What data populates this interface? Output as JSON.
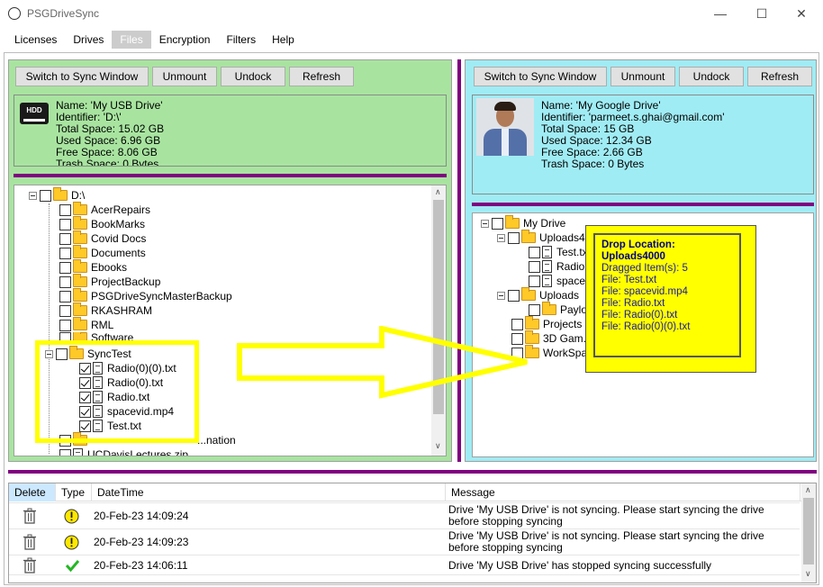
{
  "window": {
    "title": "PSGDriveSync",
    "minimize": "—",
    "maximize": "☐",
    "close": "✕"
  },
  "menu": [
    "Licenses",
    "Drives",
    "Files",
    "Encryption",
    "Filters",
    "Help"
  ],
  "menu_active": "Files",
  "left": {
    "buttons": [
      "Switch to Sync Window",
      "Unmount",
      "Undock",
      "Refresh"
    ],
    "info": {
      "icon_label": "HDD",
      "lines": [
        "Name: 'My USB Drive'",
        "Identifier: 'D:\\'",
        "Total Space: 15.02 GB",
        "Used Space: 6.96 GB",
        "Free Space: 8.06 GB",
        "Trash Space: 0 Bytes"
      ]
    },
    "tree": {
      "root": "D:\\",
      "folders": [
        "AcerRepairs",
        "BookMarks",
        "Covid Docs",
        "Documents",
        "Ebooks",
        "ProjectBackup",
        "PSGDriveSyncMasterBackup",
        "RKASHRAM",
        "RML",
        "Software",
        "SyncTest"
      ],
      "sync_files": [
        "Radio(0)(0).txt",
        "Radio(0).txt",
        "Radio.txt",
        "spacevid.mp4",
        "Test.txt"
      ],
      "partial_item": "...nation",
      "last_file": "UCDavisLectures.zip"
    }
  },
  "right": {
    "buttons": [
      "Switch to Sync Window",
      "Unmount",
      "Undock",
      "Refresh"
    ],
    "info": {
      "lines": [
        "Name: 'My Google Drive'",
        "Identifier: 'parmeet.s.ghai@gmail.com'",
        "Total Space: 15 GB",
        "Used Space: 12.34 GB",
        "Free Space: 2.66 GB",
        "Trash Space: 0 Bytes"
      ]
    },
    "tree": {
      "root": "My Drive",
      "uploads_4000": "Uploads4000",
      "uploads_children": [
        "Test.txt",
        "Radio...",
        "space..."
      ],
      "uploads2": "Uploads",
      "payload": "Paylo...",
      "folders": [
        "Projects",
        "3D Gam...",
        "WorkSpa..."
      ]
    },
    "drop_tooltip": {
      "title": "Drop Location:",
      "location": "Uploads4000",
      "count": "Dragged Item(s): 5",
      "files": [
        "File: Test.txt",
        "File: spacevid.mp4",
        "File: Radio.txt",
        "File: Radio(0).txt",
        "File: Radio(0)(0).txt"
      ]
    }
  },
  "log": {
    "columns": [
      "Delete",
      "Type",
      "DateTime",
      "Message"
    ],
    "rows": [
      {
        "type": "warning",
        "datetime": "20-Feb-23 14:09:24",
        "message": "Drive 'My USB Drive' is not syncing. Please start syncing the drive before stopping syncing"
      },
      {
        "type": "warning",
        "datetime": "20-Feb-23 14:09:23",
        "message": "Drive 'My USB Drive' is not syncing. Please start syncing the drive before stopping syncing"
      },
      {
        "type": "success",
        "datetime": "20-Feb-23 14:06:11",
        "message": "Drive 'My USB Drive' has stopped syncing successfully"
      }
    ]
  },
  "colors": {
    "left_pane": "#a8e4a0",
    "right_pane": "#a0ecf4",
    "divider": "#800080",
    "highlight": "#ffff00",
    "selected_menu": "#cccccc"
  }
}
